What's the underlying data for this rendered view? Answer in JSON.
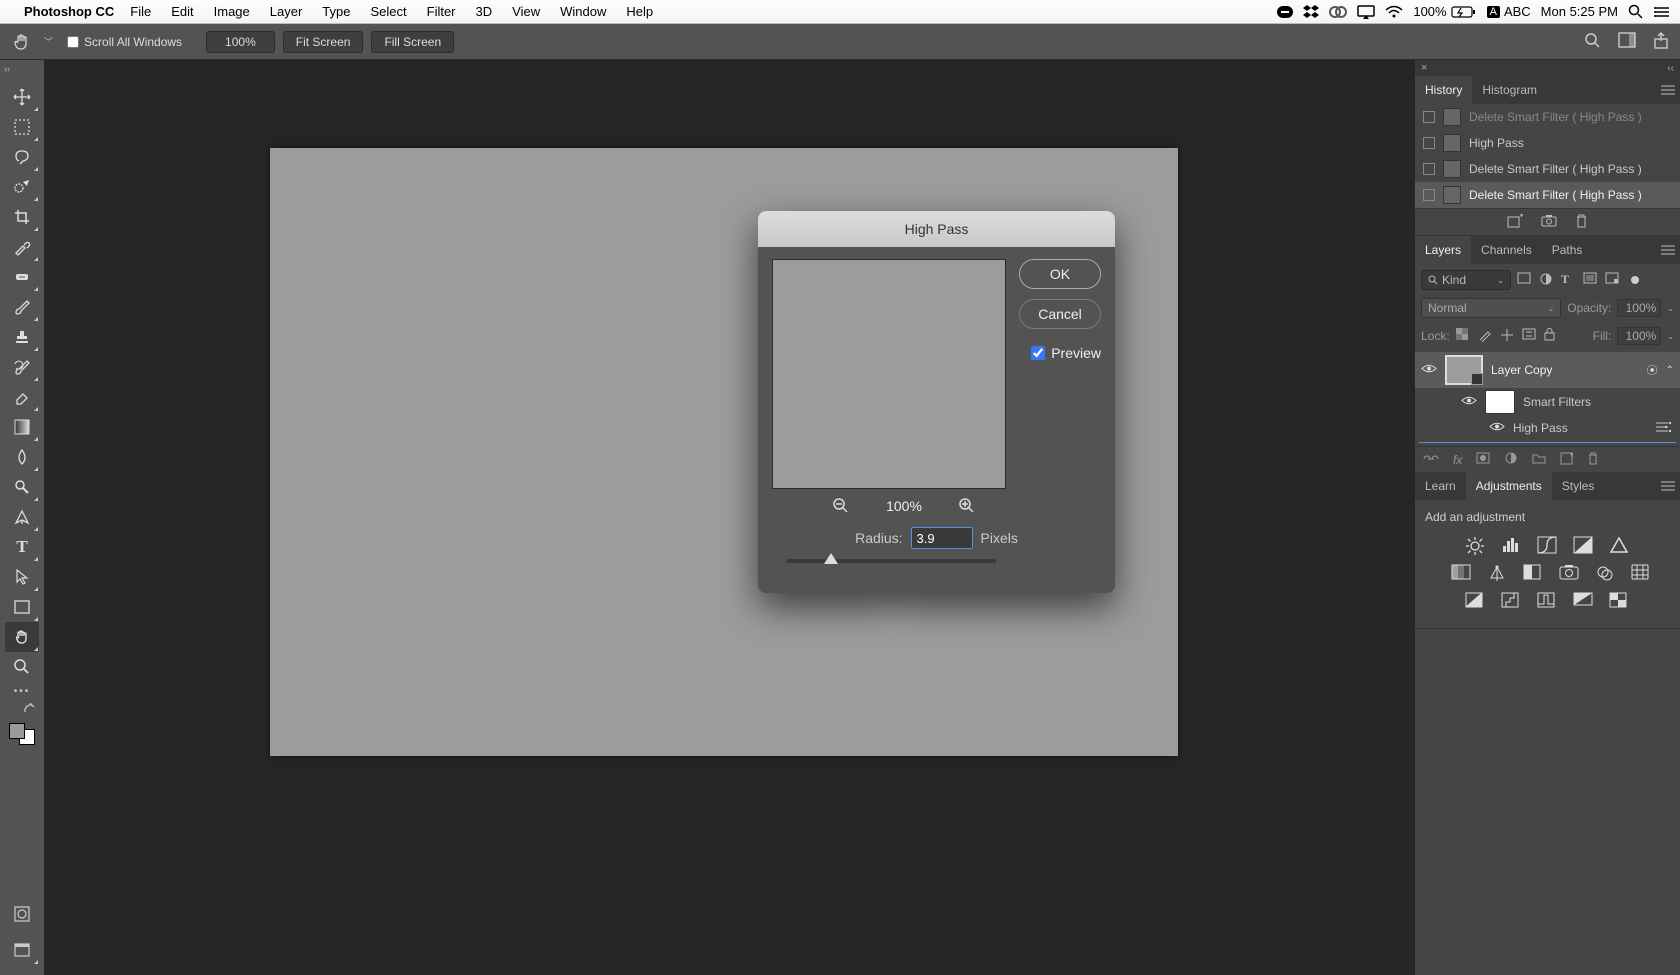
{
  "menubar": {
    "app": "Photoshop CC",
    "items": [
      "File",
      "Edit",
      "Image",
      "Layer",
      "Type",
      "Select",
      "Filter",
      "3D",
      "View",
      "Window",
      "Help"
    ],
    "battery": "100%",
    "input": "ABC",
    "clock": "Mon 5:25 PM"
  },
  "options": {
    "scroll_all": "Scroll All Windows",
    "zoom": "100%",
    "fit": "Fit Screen",
    "fill": "Fill Screen"
  },
  "dialog": {
    "title": "High Pass",
    "ok": "OK",
    "cancel": "Cancel",
    "preview": "Preview",
    "zoom": "100%",
    "radius_label": "Radius:",
    "radius_value": "3.9",
    "radius_unit": "Pixels"
  },
  "history": {
    "tab_history": "History",
    "tab_histogram": "Histogram",
    "rows": [
      "Delete Smart Filter ( High Pass )",
      "High Pass",
      "Delete Smart Filter ( High Pass )",
      "Delete Smart Filter ( High Pass )"
    ]
  },
  "layers_panel": {
    "tab_layers": "Layers",
    "tab_channels": "Channels",
    "tab_paths": "Paths",
    "kind": "Kind",
    "blend": "Normal",
    "opacity_label": "Opacity:",
    "opacity_value": "100%",
    "lock_label": "Lock:",
    "fill_label": "Fill:",
    "fill_value": "100%",
    "layer_name": "Layer Copy",
    "smart_filters": "Smart Filters",
    "filter_name": "High Pass"
  },
  "learn_panel": {
    "tab_learn": "Learn",
    "tab_adjustments": "Adjustments",
    "tab_styles": "Styles",
    "add_adj": "Add an adjustment"
  }
}
